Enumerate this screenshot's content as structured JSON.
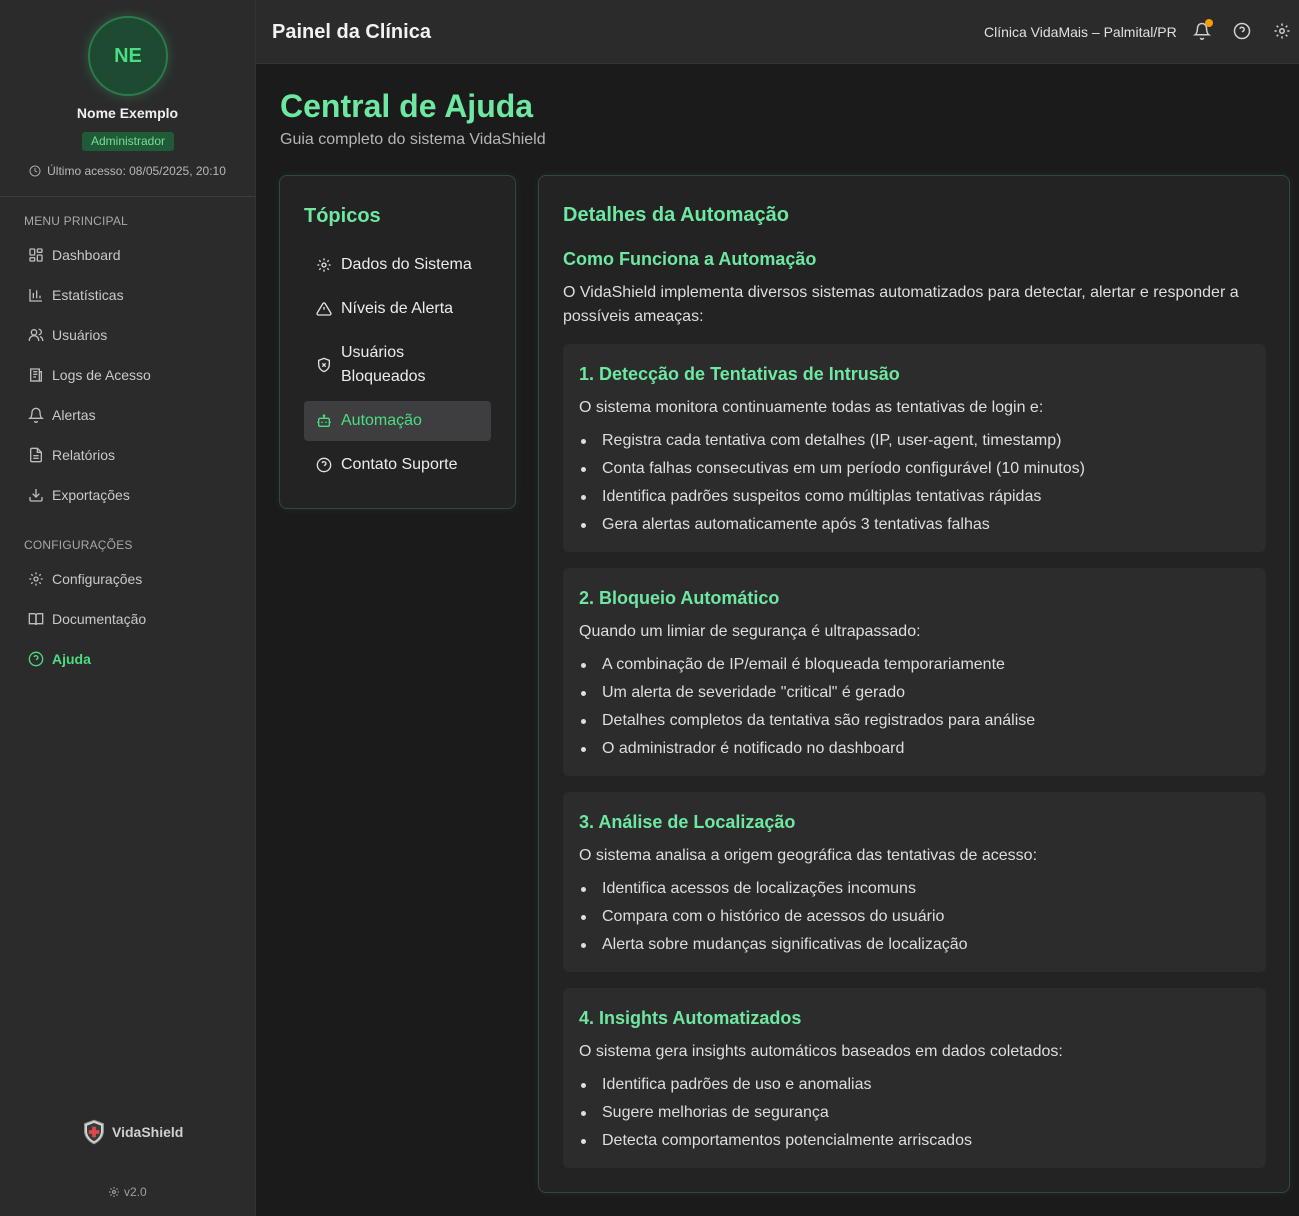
{
  "sidebar": {
    "avatar_initials": "NE",
    "user_name": "Nome Exemplo",
    "role": "Administrador",
    "last_access": "Último acesso: 08/05/2025, 20:10",
    "main_menu_title": "MENU PRINCIPAL",
    "main_menu": [
      {
        "label": "Dashboard",
        "icon": "dashboard-icon"
      },
      {
        "label": "Estatísticas",
        "icon": "bar-chart-icon"
      },
      {
        "label": "Usuários",
        "icon": "users-icon"
      },
      {
        "label": "Logs de Acesso",
        "icon": "logs-icon"
      },
      {
        "label": "Alertas",
        "icon": "bell-icon"
      },
      {
        "label": "Relatórios",
        "icon": "file-icon"
      },
      {
        "label": "Exportações",
        "icon": "download-icon"
      }
    ],
    "config_title": "CONFIGURAÇÕES",
    "config_menu": [
      {
        "label": "Configurações",
        "icon": "gear-icon"
      },
      {
        "label": "Documentação",
        "icon": "book-icon"
      },
      {
        "label": "Ajuda",
        "icon": "help-icon",
        "active": true
      }
    ],
    "brand": "VidaShield",
    "version": "v2.0"
  },
  "header": {
    "title": "Painel da Clínica",
    "clinic": "Clínica VidaMais – Palmital/PR",
    "notification_dot_color": "#f59e0b"
  },
  "main": {
    "title": "Central de Ajuda",
    "subtitle": "Guia completo do sistema VidaShield",
    "topics": {
      "title": "Tópicos",
      "items": [
        {
          "label": "Dados do Sistema",
          "icon": "gear-icon"
        },
        {
          "label": "Níveis de Alerta",
          "icon": "warning-icon"
        },
        {
          "label": "Usuários Bloqueados",
          "icon": "shield-x-icon"
        },
        {
          "label": "Automação",
          "icon": "bot-icon",
          "active": true
        },
        {
          "label": "Contato Suporte",
          "icon": "help-icon"
        }
      ]
    },
    "details": {
      "title": "Detalhes da Automação",
      "how_title": "Como Funciona a Automação",
      "intro": "O VidaShield implementa diversos sistemas automatizados para detectar, alertar e responder a possíveis ameaças:",
      "sections": [
        {
          "title": "1. Detecção de Tentativas de Intrusão",
          "desc": "O sistema monitora continuamente todas as tentativas de login e:",
          "items": [
            "Registra cada tentativa com detalhes (IP, user-agent, timestamp)",
            "Conta falhas consecutivas em um período configurável (10 minutos)",
            "Identifica padrões suspeitos como múltiplas tentativas rápidas",
            "Gera alertas automaticamente após 3 tentativas falhas"
          ]
        },
        {
          "title": "2. Bloqueio Automático",
          "desc": "Quando um limiar de segurança é ultrapassado:",
          "items": [
            "A combinação de IP/email é bloqueada temporariamente",
            "Um alerta de severidade \"critical\" é gerado",
            "Detalhes completos da tentativa são registrados para análise",
            "O administrador é notificado no dashboard"
          ]
        },
        {
          "title": "3. Análise de Localização",
          "desc": "O sistema analisa a origem geográfica das tentativas de acesso:",
          "items": [
            "Identifica acessos de localizações incomuns",
            "Compara com o histórico de acessos do usuário",
            "Alerta sobre mudanças significativas de localização"
          ]
        },
        {
          "title": "4. Insights Automatizados",
          "desc": "O sistema gera insights automáticos baseados em dados coletados:",
          "items": [
            "Identifica padrões de uso e anomalias",
            "Sugere melhorias de segurança",
            "Detecta comportamentos potencialmente arriscados"
          ]
        }
      ]
    }
  },
  "colors": {
    "accent": "#4ade80",
    "heading": "#6ee7a0",
    "background": "#1b1b1b",
    "panel": "#2b2b2b"
  }
}
